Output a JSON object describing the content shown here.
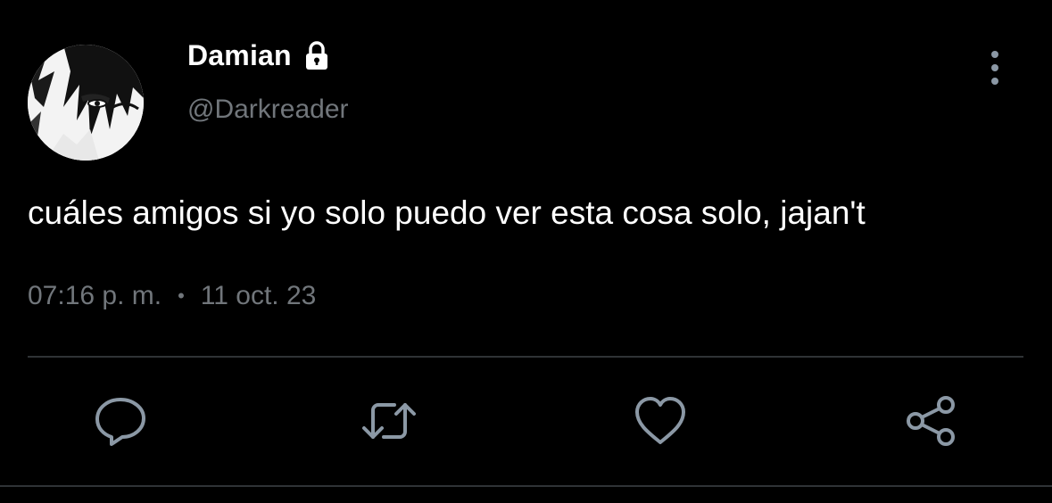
{
  "tweet": {
    "author": {
      "display_name": "Damian",
      "handle": "@Darkreader",
      "protected": true,
      "avatar_icon": "manga-avatar-icon"
    },
    "text": "cuáles amigos si yo solo puedo ver esta cosa solo, jajan't",
    "time": "07:16 p. m.",
    "separator": "•",
    "date": "11 oct. 23"
  },
  "actions": [
    {
      "name": "reply",
      "icon": "reply-icon"
    },
    {
      "name": "retweet",
      "icon": "retweet-icon"
    },
    {
      "name": "like",
      "icon": "heart-icon"
    },
    {
      "name": "share",
      "icon": "share-icon"
    }
  ],
  "colors": {
    "background": "#000000",
    "text_primary": "#ffffff",
    "text_secondary": "#71767b",
    "divider": "#2f3336"
  }
}
